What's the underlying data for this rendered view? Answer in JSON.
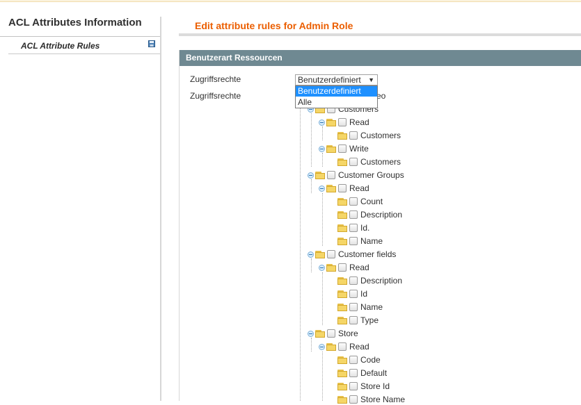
{
  "sidebar": {
    "title": "ACL Attributes Information",
    "tab_label": "ACL Attribute Rules",
    "tab_icon": "save-icon"
  },
  "header": {
    "title": "Edit attribute rules for Admin Role"
  },
  "section": {
    "title": "Benutzerart Ressourcen",
    "label_access": "Zugriffsrechte",
    "label_access_2": "Zugriffsrechte"
  },
  "select": {
    "value": "Benutzerdefiniert",
    "options": [
      "Benutzerdefiniert",
      "Alle"
    ],
    "highlighted": "Benutzerdefiniert"
  },
  "tree": {
    "hidden_root_partial": "eo",
    "nodes": [
      {
        "label": "Customers",
        "depth": 0
      },
      {
        "label": "Read",
        "depth": 1
      },
      {
        "label": "Customers",
        "depth": 2
      },
      {
        "label": "Write",
        "depth": 1
      },
      {
        "label": "Customers",
        "depth": 2
      },
      {
        "label": "Customer Groups",
        "depth": 0
      },
      {
        "label": "Read",
        "depth": 1
      },
      {
        "label": "Count",
        "depth": 2
      },
      {
        "label": "Description",
        "depth": 2
      },
      {
        "label": "Id.",
        "depth": 2
      },
      {
        "label": "Name",
        "depth": 2
      },
      {
        "label": "Customer fields",
        "depth": 0
      },
      {
        "label": "Read",
        "depth": 1
      },
      {
        "label": "Description",
        "depth": 2
      },
      {
        "label": "Id",
        "depth": 2
      },
      {
        "label": "Name",
        "depth": 2
      },
      {
        "label": "Type",
        "depth": 2
      },
      {
        "label": "Store",
        "depth": 0
      },
      {
        "label": "Read",
        "depth": 1
      },
      {
        "label": "Code",
        "depth": 2
      },
      {
        "label": "Default",
        "depth": 2
      },
      {
        "label": "Store Id",
        "depth": 2
      },
      {
        "label": "Store Name",
        "depth": 2
      }
    ]
  }
}
